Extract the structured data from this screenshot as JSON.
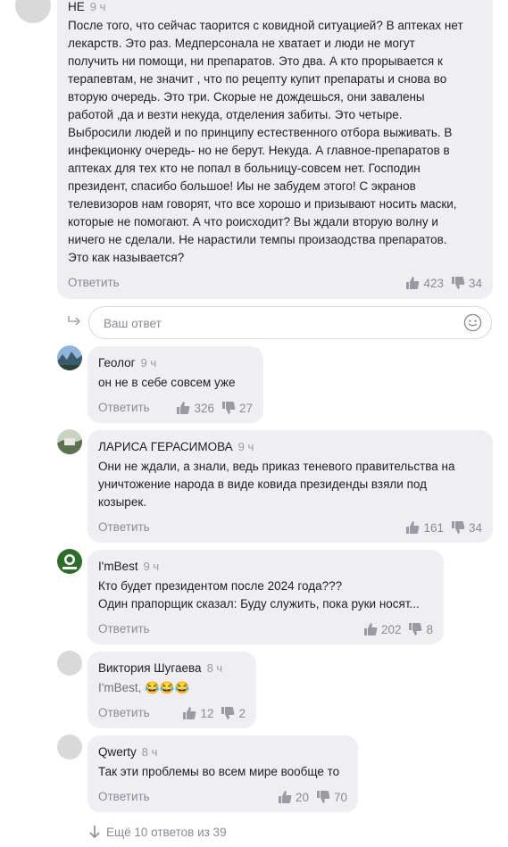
{
  "comment_main": {
    "author": "НЕ",
    "time": "9 ч",
    "text_lines": [
      "После того, что сейчас таорится с ковидной ситуацией? В аптеках нет",
      "лекарств. Это раз. Медперсонала не хватает и люди не могут",
      "получить ни помощи, ни препаратов. Это два. А кто прорывается к",
      "терапевтам, не значит , что по рецепту купит препараты и снова во",
      "вторую очередь. Это три. Скорые не дождешься, они завалены",
      "работой ,да и везти некуда, отделения забиты. Это четыре.",
      "Выбросили людей и по принципу естественного отбора выживать. В",
      "инфекционку очередь- но не берут. Некуда.  А главное-препаратов в",
      "аптеках для тех кто не попал в больницу-совсем нет. Господин",
      "президент, спасибо большое! Иы не забудем этого! С экранов",
      "телевизоров нам говорят, что все хорошо и призывают носить маски,",
      "которые не помогают.  А что роисходит? Вы ждали вторую волну и",
      "ничего не сделали. Не нарастили темпы произаодства препаратов.",
      "Это как называется?"
    ],
    "reply_label": "Ответить",
    "likes": "423",
    "dislikes": "34"
  },
  "reply_input": {
    "placeholder": "Ваш ответ"
  },
  "replies": [
    {
      "author": "Геолог",
      "time": "9 ч",
      "text_lines": [
        "он не в себе совсем уже"
      ],
      "reply_label": "Ответить",
      "likes": "326",
      "dislikes": "27"
    },
    {
      "author": "ЛАРИСА ГЕРАСИМОВА",
      "time": "9 ч",
      "text_lines": [
        "Они не ждали, а знали, ведь приказ теневого правительства на",
        "уничтожение народа в виде ковида президенды взяли под",
        "козырек."
      ],
      "reply_label": "Ответить",
      "likes": "161",
      "dislikes": "34"
    },
    {
      "author": "I'mBest",
      "time": "9 ч",
      "text_lines": [
        "Кто будет президентом после 2024 года???",
        "Один прапорщик сказал: Буду служить, пока руки носят..."
      ],
      "reply_label": "Ответить",
      "likes": "202",
      "dislikes": "8"
    },
    {
      "author": "Виктория Шугаева",
      "time": "8 ч",
      "mention": "I'mBest,",
      "text": "😂😂😂",
      "reply_label": "Ответить",
      "likes": "12",
      "dislikes": "2"
    },
    {
      "author": "Qwerty",
      "time": "8 ч",
      "text_lines": [
        "Так эти проблемы во всем мире вообще то"
      ],
      "reply_label": "Ответить",
      "likes": "20",
      "dislikes": "70"
    }
  ],
  "more_replies": "Ещё 10 ответов из 39",
  "colors": {
    "bubble": "#efeff3",
    "muted": "#8a8a94",
    "text": "#1f1f1f"
  },
  "icons": [
    "thumb-up-icon",
    "thumb-down-icon",
    "reply-arrow-icon",
    "emoji-icon",
    "arrow-down-icon"
  ]
}
